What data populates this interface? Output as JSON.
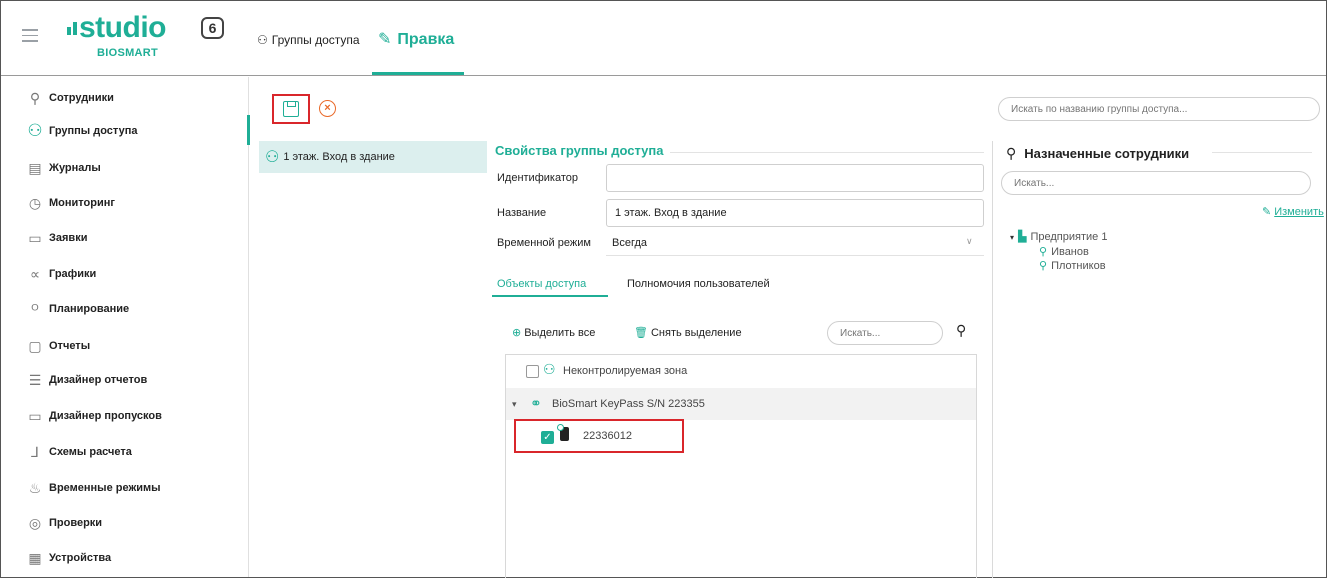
{
  "app": {
    "logo_word": "studio",
    "logo_version": "6",
    "logo_sub": "BIOSMART"
  },
  "breadcrumb": {
    "groups": "Группы доступа",
    "edit": "Правка"
  },
  "sidebar": {
    "items": [
      {
        "label": "Сотрудники",
        "icon": "person-icon"
      },
      {
        "label": "Группы доступа",
        "icon": "people-icon"
      },
      {
        "label": "Журналы",
        "icon": "journal-icon"
      },
      {
        "label": "Мониторинг",
        "icon": "monitoring-icon"
      },
      {
        "label": "Заявки",
        "icon": "requests-icon"
      },
      {
        "label": "Графики",
        "icon": "graphs-icon"
      },
      {
        "label": "Планирование",
        "icon": "planning-icon"
      },
      {
        "label": "Отчеты",
        "icon": "reports-icon"
      },
      {
        "label": "Дизайнер отчетов",
        "icon": "report-designer-icon"
      },
      {
        "label": "Дизайнер пропусков",
        "icon": "pass-designer-icon"
      },
      {
        "label": "Схемы расчета",
        "icon": "calc-scheme-icon"
      },
      {
        "label": "Временные режимы",
        "icon": "time-modes-icon"
      },
      {
        "label": "Проверки",
        "icon": "checks-icon"
      },
      {
        "label": "Устройства",
        "icon": "devices-icon"
      }
    ],
    "active_index": 1
  },
  "groups_list": {
    "items": [
      "1 этаж. Вход в здание"
    ]
  },
  "properties": {
    "title": "Свойства группы доступа",
    "id_label": "Идентификатор",
    "id_value": "",
    "name_label": "Название",
    "name_value": "1 этаж. Вход в здание",
    "time_mode_label": "Временной режим",
    "time_mode_value": "Всегда"
  },
  "tabs": {
    "objects": "Объекты доступа",
    "permissions": "Полномочия пользователей"
  },
  "objects": {
    "select_all": "Выделить все",
    "clear_selection": "Снять выделение",
    "search_placeholder": "Искать...",
    "tree": {
      "uncontrolled_zone": "Неконтролируемая зона",
      "device": "BioSmart KeyPass S/N 223355",
      "reader": "22336012"
    }
  },
  "right_panel": {
    "group_search_placeholder": "Искать по названию группы доступа...",
    "assigned_title": "Назначенные сотрудники",
    "employee_search_placeholder": "Искать...",
    "change_link": "Изменить",
    "org_name": "Предприятие 1",
    "employees": [
      "Иванов",
      "Плотников"
    ]
  },
  "colors": {
    "accent": "#1fae96",
    "highlight": "#d9262b",
    "cancel": "#e96a2a"
  }
}
